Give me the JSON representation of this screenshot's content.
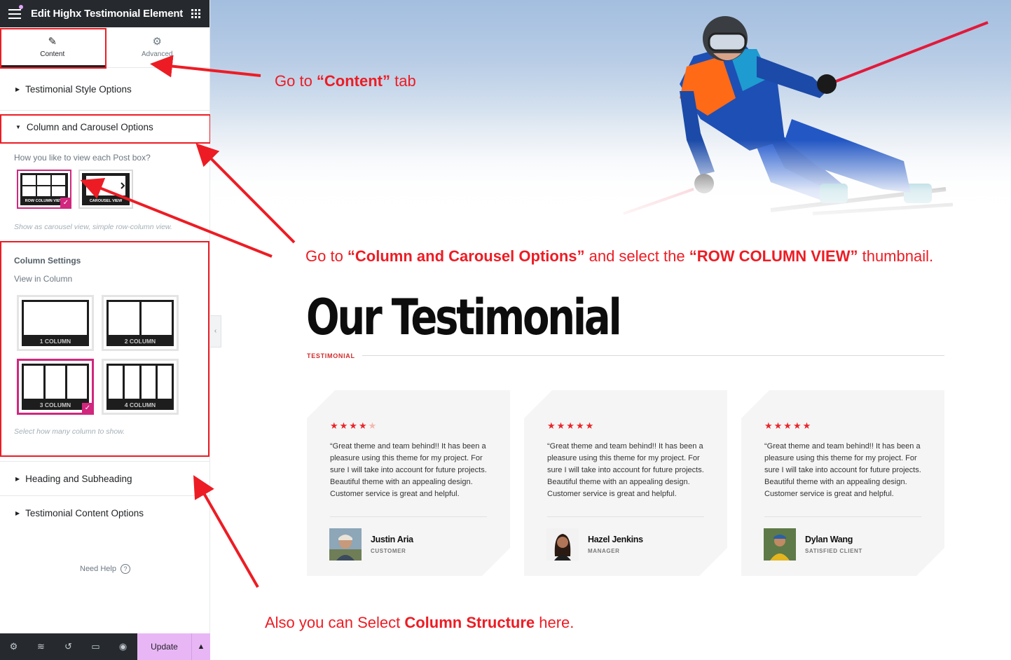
{
  "editor": {
    "title": "Edit Highx Testimonial Element",
    "tabs": [
      {
        "label": "Content"
      },
      {
        "label": "Advanced"
      }
    ],
    "sections": {
      "testimonial_style": "Testimonial Style Options",
      "column_carousel": "Column and Carousel Options",
      "heading_subheading": "Heading and Subheading",
      "testimonial_content": "Testimonial Content Options"
    },
    "view_question": "How you like to view each Post box?",
    "view_options": [
      {
        "label": "ROW COLUMN VIEW",
        "selected": true
      },
      {
        "label": "CAROUSEL VIEW",
        "selected": false
      }
    ],
    "view_hint": "Show as carousel view, simple row-column view.",
    "column_settings_title": "Column Settings",
    "view_in_column": "View in Column",
    "column_options": [
      {
        "label": "1 COLUMN",
        "selected": false
      },
      {
        "label": "2 COLUMN",
        "selected": false
      },
      {
        "label": "3 COLUMN",
        "selected": true
      },
      {
        "label": "4 COLUMN",
        "selected": false
      }
    ],
    "column_hint": "Select how many column to show.",
    "need_help": "Need Help",
    "update_label": "Update",
    "footer_icons": [
      "settings-icon",
      "layers-icon",
      "history-icon",
      "responsive-icon",
      "preview-icon"
    ]
  },
  "annotations": {
    "content_tab": {
      "pre": "Go  to ",
      "bold": "“Content”",
      "post": " tab"
    },
    "column_carousel": {
      "pre": "Go to ",
      "bold1": "“Column and Carousel Options”",
      "mid": " and select the ",
      "bold2": "“ROW COLUMN VIEW”",
      "post": " thumbnail."
    },
    "column_structure": {
      "pre": "Also you can Select ",
      "bold": "Column Structure",
      "post": " here."
    }
  },
  "preview": {
    "heading": "Our Testimonial",
    "subheading": "TESTIMONIAL",
    "cards": [
      {
        "rating": 4,
        "quote": "“Great theme and team behind!! It has been a pleasure using this theme for my project. For sure I will take into account for future projects. Beautiful theme with an appealing design. Customer service is great and helpful.",
        "name": "Justin Aria",
        "role": "CUSTOMER"
      },
      {
        "rating": 5,
        "quote": "“Great theme and team behind!! It has been a pleasure using this theme for my project. For sure I will take into account for future projects. Beautiful theme with an appealing design. Customer service is great and helpful.",
        "name": "Hazel Jenkins",
        "role": "MANAGER"
      },
      {
        "rating": 5,
        "quote": "“Great theme and team behind!! It has been a pleasure using this theme for my project. For sure I will take into account for future projects. Beautiful theme with an appealing design. Customer service is great and helpful.",
        "name": "Dylan Wang",
        "role": "SATISFIED CLIENT"
      }
    ]
  },
  "colors": {
    "annotation_red": "#ed1c24",
    "accent_pink": "#d1277e",
    "update_bg": "#e8b6f5",
    "star_red": "#e9262b"
  }
}
